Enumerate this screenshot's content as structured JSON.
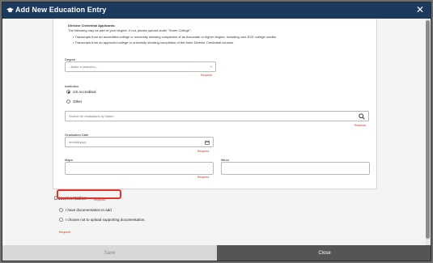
{
  "modal": {
    "title": "Add New Education Entry",
    "close_symbol": "✕"
  },
  "director": {
    "heading": "Director Credential Applicants:",
    "intro": "The following may be part of your degree. If not, please upload under \"Some College\":",
    "bullets": [
      "Transcripts from an accredited college or university showing completion of an Associate or higher degree, including core ECE college credits.",
      "Transcripts from an approved college or university showing completion of the three Director Credential courses."
    ]
  },
  "degree": {
    "label": "Degree",
    "placeholder": "--Make a selection--",
    "required": "Required"
  },
  "institution": {
    "label": "Institution",
    "options": [
      "US Accredited",
      "Other"
    ],
    "selected": "US Accredited",
    "search_placeholder": "Search for institutions by Name",
    "required": "Required"
  },
  "graduation": {
    "label": "Graduation Date",
    "placeholder": "mm/dd/yyyy",
    "required": "Required"
  },
  "major": {
    "label": "Major",
    "required": "Required"
  },
  "minor": {
    "label": "Minor"
  },
  "documentation": {
    "label": "Documentation",
    "required": "Required",
    "options": [
      "I have documentation to add",
      "I choose not to upload supporting documentation."
    ],
    "bottom_required": "Required"
  },
  "footer": {
    "save_label": "Save",
    "close_label": "Close"
  },
  "colors": {
    "titlebar": "#1c3a5e",
    "highlight": "#e2342a"
  }
}
